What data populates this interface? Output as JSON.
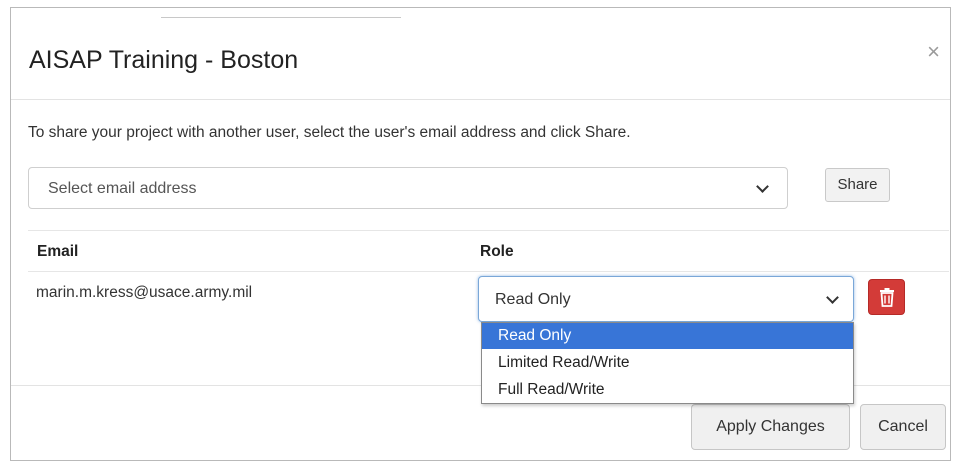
{
  "modal": {
    "title": "AISAP Training - Boston",
    "close_label": "×",
    "instructions": "To share your project with another user, select the user's email address and click Share."
  },
  "share": {
    "email_placeholder": "Select email address",
    "share_label": "Share"
  },
  "table": {
    "headers": {
      "email": "Email",
      "role": "Role"
    },
    "rows": [
      {
        "email": "marin.m.kress@usace.army.mil",
        "role": "Read Only"
      }
    ]
  },
  "role_dropdown": {
    "options": [
      "Read Only",
      "Limited Read/Write",
      "Full Read/Write"
    ],
    "selected": "Read Only"
  },
  "footer": {
    "apply_label": "Apply Changes",
    "cancel_label": "Cancel"
  },
  "colors": {
    "delete_button": "#d33b38",
    "option_highlight": "#3875d7"
  },
  "icons": {
    "delete": "trash-icon",
    "close": "close-icon",
    "dropdown": "chevron-down-icon"
  }
}
